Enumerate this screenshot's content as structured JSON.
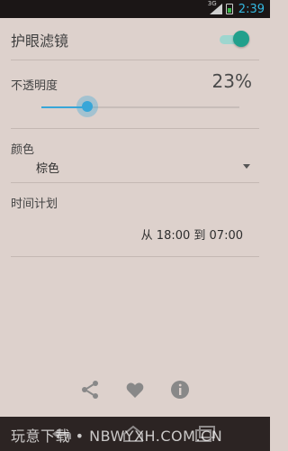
{
  "status_bar": {
    "network_label": "3G",
    "time": "2:39"
  },
  "header": {
    "title": "护眼滤镜",
    "enabled": true
  },
  "opacity": {
    "label": "不透明度",
    "value_text": "23%",
    "value": 23
  },
  "color": {
    "label": "颜色",
    "selected": "棕色"
  },
  "schedule": {
    "label": "时间计划",
    "value_text": "从 18:00 到 07:00"
  },
  "actions": {
    "share_icon": "share-icon",
    "heart_icon": "heart-icon",
    "info_icon": "info-icon"
  },
  "watermark": {
    "text": "玩意下载 • NBWYXH.COM.CN"
  },
  "colors": {
    "background": "#ddd1cc",
    "accent_teal": "#21a08c",
    "accent_blue": "#37a6d8",
    "status_bar": "#1b1616"
  }
}
